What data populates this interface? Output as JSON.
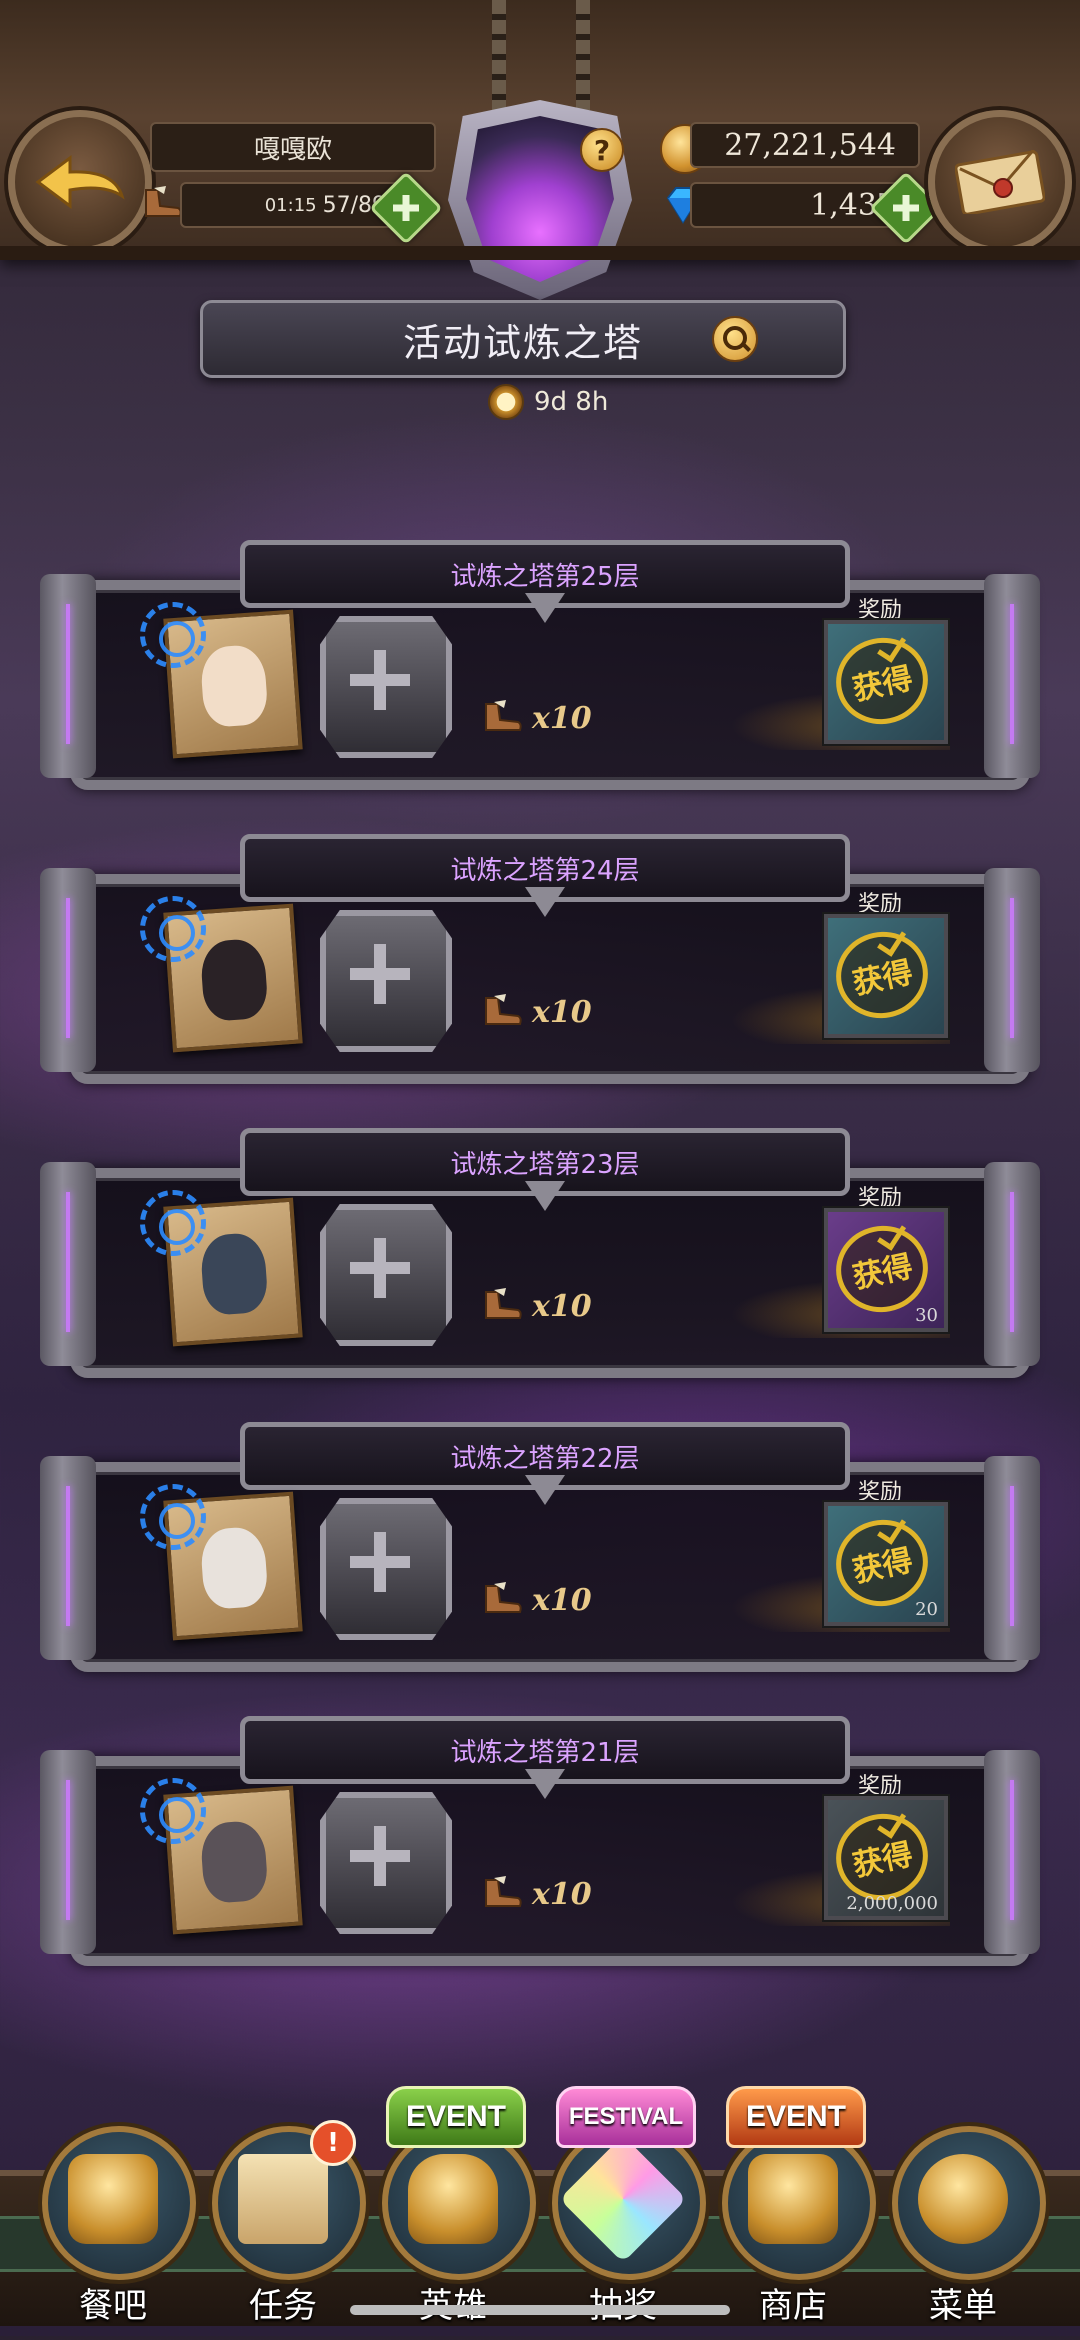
{
  "header": {
    "player_name": "嘎嘎欧",
    "stamina_timer": "01:15",
    "stamina": "57/89",
    "gold": "27,221,544",
    "gems": "1,437",
    "help_label": "?"
  },
  "event": {
    "title": "活动试炼之塔",
    "time_left": "9d 8h"
  },
  "floors": [
    {
      "title": "试炼之塔第25层",
      "cost": "x10",
      "reward_label": "奖励",
      "stamp": "获得",
      "qty": "",
      "box": "teal"
    },
    {
      "title": "试炼之塔第24层",
      "cost": "x10",
      "reward_label": "奖励",
      "stamp": "获得",
      "qty": "",
      "box": "teal"
    },
    {
      "title": "试炼之塔第23层",
      "cost": "x10",
      "reward_label": "奖励",
      "stamp": "获得",
      "qty": "30",
      "box": "purple"
    },
    {
      "title": "试炼之塔第22层",
      "cost": "x10",
      "reward_label": "奖励",
      "stamp": "获得",
      "qty": "20",
      "box": "teal"
    },
    {
      "title": "试炼之塔第21层",
      "cost": "x10",
      "reward_label": "奖励",
      "stamp": "获得",
      "qty": "2,000,000",
      "box": "gray"
    }
  ],
  "nav": [
    {
      "label": "餐吧",
      "tag": ""
    },
    {
      "label": "任务",
      "tag": "",
      "badge": "!"
    },
    {
      "label": "英雄",
      "tag": "EVENT"
    },
    {
      "label": "抽奖",
      "tag": "FESTIVAL"
    },
    {
      "label": "商店",
      "tag": "EVENT"
    },
    {
      "label": "菜单",
      "tag": ""
    }
  ],
  "colors": {
    "accent_purple": "#dba3ff",
    "stamp_gold": "#f3c83a",
    "plus_green": "#4a8a28",
    "nav_frame": "#a37a3c"
  },
  "icons": [
    "back-arrow-icon",
    "mail-icon",
    "boot-icon",
    "gold-coin-icon",
    "gem-icon",
    "help-icon",
    "search-icon",
    "clock-icon",
    "tower-crest-icon"
  ]
}
